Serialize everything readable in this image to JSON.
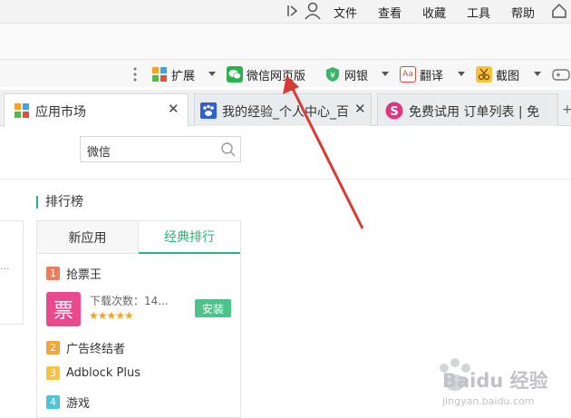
{
  "menubar": {
    "items": [
      "文件",
      "查看",
      "收藏",
      "工具",
      "帮助"
    ]
  },
  "toolbar": {
    "extensions_label": "扩展",
    "wechat_label": "微信网页版",
    "bank_label": "网银",
    "translate_label": "翻译",
    "screenshot_label": "截图",
    "translate_icon_text": "Aa"
  },
  "tabs": [
    {
      "label": "应用市场",
      "active": true
    },
    {
      "label": "我的经验_个人中心_百",
      "active": false
    },
    {
      "label": "免费试用 订单列表 | 免",
      "active": false
    }
  ],
  "search": {
    "value": "微信"
  },
  "ranking": {
    "title": "排行榜",
    "tabs": [
      "新应用",
      "经典排行"
    ],
    "active_tab": 1,
    "items": [
      {
        "rank": "1",
        "name": "抢票王",
        "color": "#f07a5a"
      },
      {
        "rank": "2",
        "name": "广告终结者",
        "color": "#f3a53b"
      },
      {
        "rank": "3",
        "name": "Adblock Plus",
        "color": "#f5c242"
      },
      {
        "rank": "4",
        "name": "游戏",
        "color": "#4ec3d9"
      }
    ],
    "featured": {
      "icon_text": "票",
      "downloads": "下载次数：14...",
      "stars": "★★★★★",
      "install_label": "安装"
    }
  },
  "left_partial_text": "...",
  "watermark": {
    "brand": "Baidu 经验",
    "url": "jingyan.baidu.com"
  },
  "colors": {
    "accent": "#2bb673",
    "arrow": "#d83a34",
    "install": "#4cc38a"
  }
}
